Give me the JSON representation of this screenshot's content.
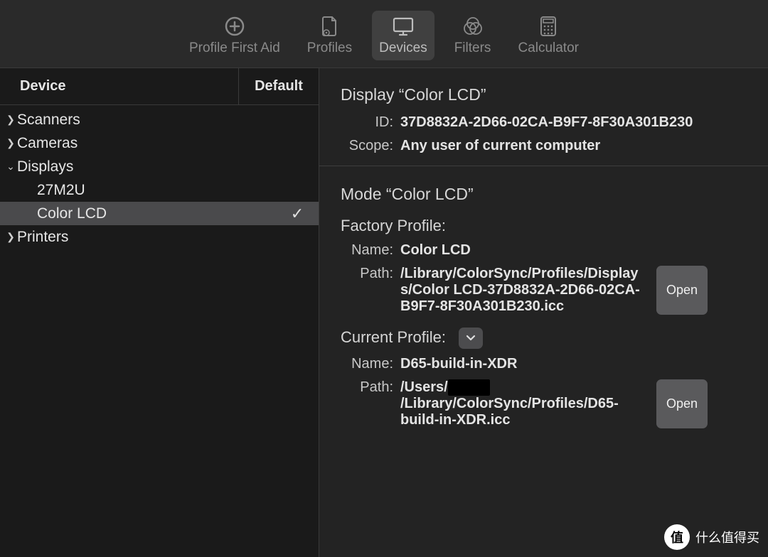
{
  "toolbar": {
    "items": [
      {
        "label": "Profile First Aid"
      },
      {
        "label": "Profiles"
      },
      {
        "label": "Devices"
      },
      {
        "label": "Filters"
      },
      {
        "label": "Calculator"
      }
    ],
    "active_index": 2
  },
  "sidebar": {
    "columns": {
      "device": "Device",
      "default": "Default"
    },
    "tree": [
      {
        "label": "Scanners",
        "expanded": false
      },
      {
        "label": "Cameras",
        "expanded": false
      },
      {
        "label": "Displays",
        "expanded": true,
        "children": [
          {
            "label": "27M2U",
            "default": false,
            "selected": false
          },
          {
            "label": "Color LCD",
            "default": true,
            "selected": true
          }
        ]
      },
      {
        "label": "Printers",
        "expanded": false
      }
    ]
  },
  "detail": {
    "display_heading": "Display “Color LCD”",
    "id_label": "ID:",
    "id_value": "37D8832A-2D66-02CA-B9F7-8F30A301B230",
    "scope_label": "Scope:",
    "scope_value": "Any user of current computer",
    "mode_heading": "Mode “Color LCD”",
    "factory_heading": "Factory Profile:",
    "name_label": "Name:",
    "factory_name": "Color LCD",
    "path_label": "Path:",
    "factory_path": "/Library/ColorSync/Profiles/Displays/Color LCD-37D8832A-2D66-02CA-B9F7-8F30A301B230.icc",
    "current_heading": "Current Profile:",
    "current_name": "D65-build-in-XDR",
    "current_path_prefix": "/Users/",
    "current_path_suffix": "/Library/ColorSync/Profiles/D65-build-in-XDR.icc",
    "open_label": "Open"
  },
  "watermark": {
    "badge": "值",
    "text": "什么值得买"
  }
}
